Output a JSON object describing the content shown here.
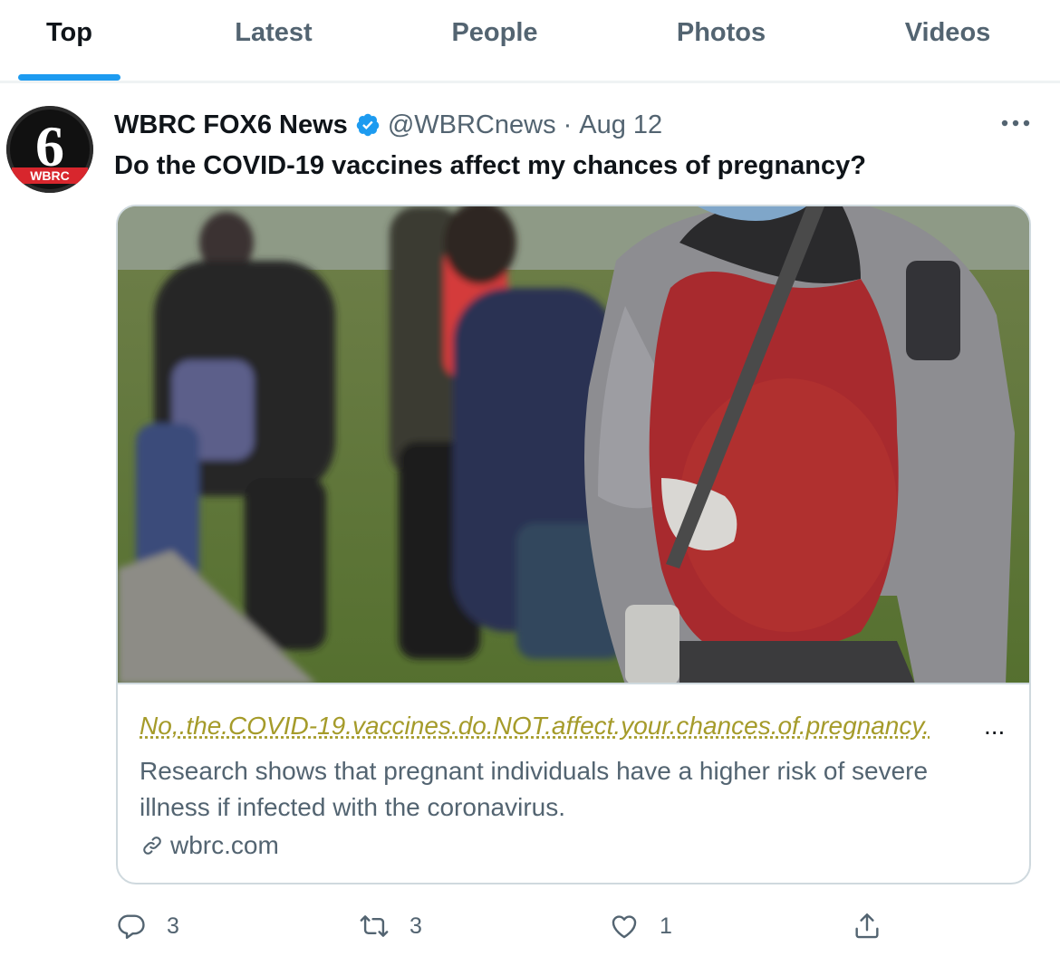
{
  "tabs": [
    {
      "label": "Top",
      "active": true
    },
    {
      "label": "Latest",
      "active": false
    },
    {
      "label": "People",
      "active": false
    },
    {
      "label": "Photos",
      "active": false
    },
    {
      "label": "Videos",
      "active": false
    }
  ],
  "tweet": {
    "avatar_text": "6",
    "avatar_sub": "WBRC",
    "display_name": "WBRC FOX6 News",
    "verified": true,
    "handle": "@WBRCnews",
    "separator": "·",
    "date": "Aug 12",
    "text": "Do the COVID-19 vaccines affect my chances of pregnancy?",
    "more_icon": "more-icon"
  },
  "card": {
    "title": "No,.the.COVID-19.vaccines.do.NOT.affect.your.chances.of.pregnancy.",
    "ellipsis": "...",
    "description": "Research shows that pregnant individuals have a higher risk of severe illness if infected with the coronavirus.",
    "domain": "wbrc.com",
    "link_icon": "link-icon"
  },
  "actions": {
    "reply_count": "3",
    "retweet_count": "3",
    "like_count": "1"
  },
  "colors": {
    "accent": "#1d9bf0",
    "muted": "#536471",
    "title_link": "#a59b2a"
  }
}
